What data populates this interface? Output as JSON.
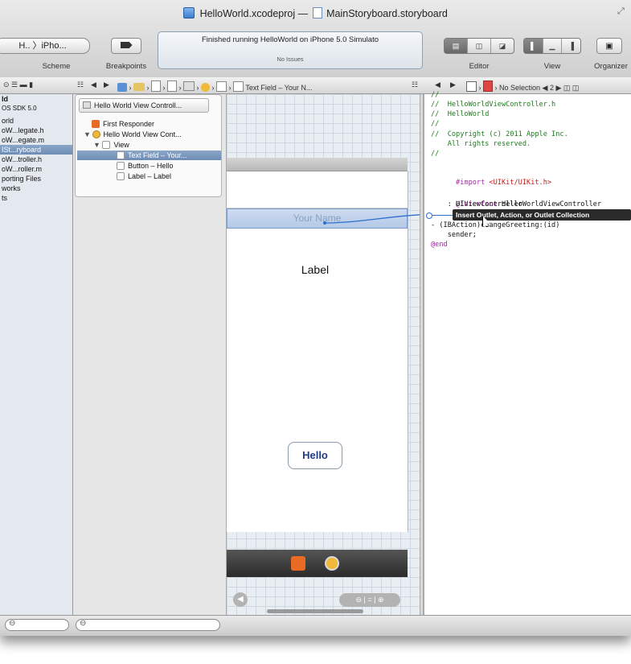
{
  "window": {
    "project_title": "HelloWorld.xcodeproj",
    "separator": "—",
    "file_title": "MainStoryboard.storyboard"
  },
  "toolbar": {
    "scheme_label": "Scheme",
    "scheme_value": "H.. 〉iPho...",
    "breakpoints_label": "Breakpoints",
    "status_text": "Finished running HelloWorld on iPhone 5.0 Simulato",
    "status_sub": "No Issues",
    "editor_label": "Editor",
    "view_label": "View",
    "organizer_label": "Organizer"
  },
  "jumpbar_left": {
    "crumb_last": "Text Field – Your N..."
  },
  "jumpbar_right": {
    "selection": "No Selection",
    "counter": "◀ 2 ▶"
  },
  "navigator": {
    "items": [
      {
        "label": "ld"
      },
      {
        "label": "OS SDK 5.0"
      },
      {
        "label": "orld"
      },
      {
        "label": "oW...legate.h"
      },
      {
        "label": "oW...egate.m"
      },
      {
        "label": "ISt...ryboard"
      },
      {
        "label": "oW...troller.h"
      },
      {
        "label": "oW...roller.m"
      },
      {
        "label": "porting Files"
      },
      {
        "label": "works"
      },
      {
        "label": "ts"
      }
    ]
  },
  "outline": {
    "header": "Hello World View Controll...",
    "rows": [
      {
        "label": "First Responder"
      },
      {
        "label": "Hello World View Cont..."
      },
      {
        "label": "View"
      },
      {
        "label": "Text Field – Your..."
      },
      {
        "label": "Button – Hello"
      },
      {
        "label": "Label – Label"
      }
    ]
  },
  "canvas": {
    "textfield_placeholder": "Your Name",
    "label_text": "Label",
    "button_text": "Hello"
  },
  "code": {
    "lines": [
      "//",
      "//  HelloWorldViewController.h",
      "//  HelloWorld",
      "//",
      "//  Copyright (c) 2011 Apple Inc.",
      "    All rights reserved.",
      "//",
      "",
      "#import <UIKit/UIKit.h>",
      "",
      "@interface HelloWorldViewController",
      "    : UIViewController",
      "- (IBAction)changeGreeting:(id)",
      "    sender;",
      "@end"
    ],
    "import_kw": "#import",
    "import_str": "<UIKit/UIKit.h>",
    "interface_kw": "@interface",
    "interface_name": "HelloWorldViewController",
    "end_kw": "@end"
  },
  "tooltip": {
    "text": "Insert Outlet, Action, or Outlet Collection"
  },
  "colors": {
    "selection": "#7896bd",
    "comment": "#1f7a1f",
    "keyword": "#a12aa1",
    "string": "#c41a16",
    "connection": "#2d6fd0"
  }
}
